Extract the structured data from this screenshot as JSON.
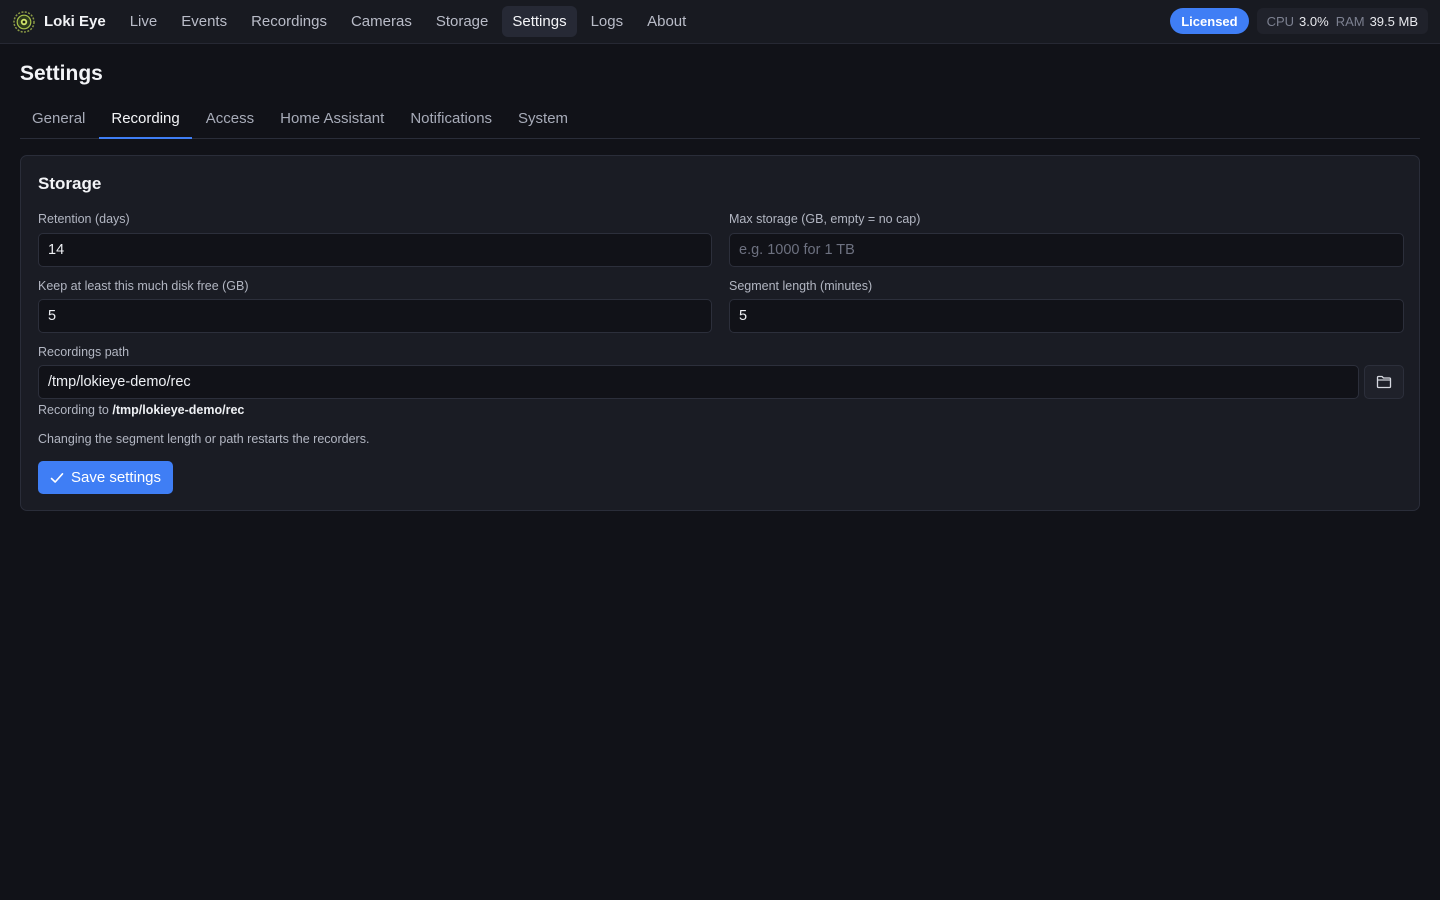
{
  "app": {
    "name": "Loki Eye",
    "logo_icon": "eye-logo-icon"
  },
  "nav": {
    "items": [
      {
        "label": "Live"
      },
      {
        "label": "Events"
      },
      {
        "label": "Recordings"
      },
      {
        "label": "Cameras"
      },
      {
        "label": "Storage"
      },
      {
        "label": "Settings"
      },
      {
        "label": "Logs"
      },
      {
        "label": "About"
      }
    ],
    "active": "Settings"
  },
  "status": {
    "license": "Licensed",
    "cpu_label": "CPU",
    "cpu_value": "3.0%",
    "ram_label": "RAM",
    "ram_value": "39.5 MB"
  },
  "page": {
    "title": "Settings",
    "tabs": [
      {
        "label": "General"
      },
      {
        "label": "Recording"
      },
      {
        "label": "Access"
      },
      {
        "label": "Home Assistant"
      },
      {
        "label": "Notifications"
      },
      {
        "label": "System"
      }
    ],
    "active_tab": "Recording"
  },
  "storage": {
    "title": "Storage",
    "retention": {
      "label": "Retention (days)",
      "value": "14"
    },
    "max_storage": {
      "label": "Max storage (GB, empty = no cap)",
      "value": "",
      "placeholder": "e.g. 1000 for 1 TB"
    },
    "min_free": {
      "label": "Keep at least this much disk free (GB)",
      "value": "5"
    },
    "segment_length": {
      "label": "Segment length (minutes)",
      "value": "5"
    },
    "path": {
      "label": "Recordings path",
      "value": "/tmp/lokieye-demo/rec",
      "browse_icon": "folder-icon"
    },
    "recording_to_prefix": "Recording to",
    "recording_to_path": "/tmp/lokieye-demo/rec",
    "help": "Changing the segment length or path restarts the recorders.",
    "save_label": "Save settings"
  },
  "colors": {
    "accent": "#3f7ef5",
    "background": "#111218",
    "card": "#1a1c24"
  }
}
